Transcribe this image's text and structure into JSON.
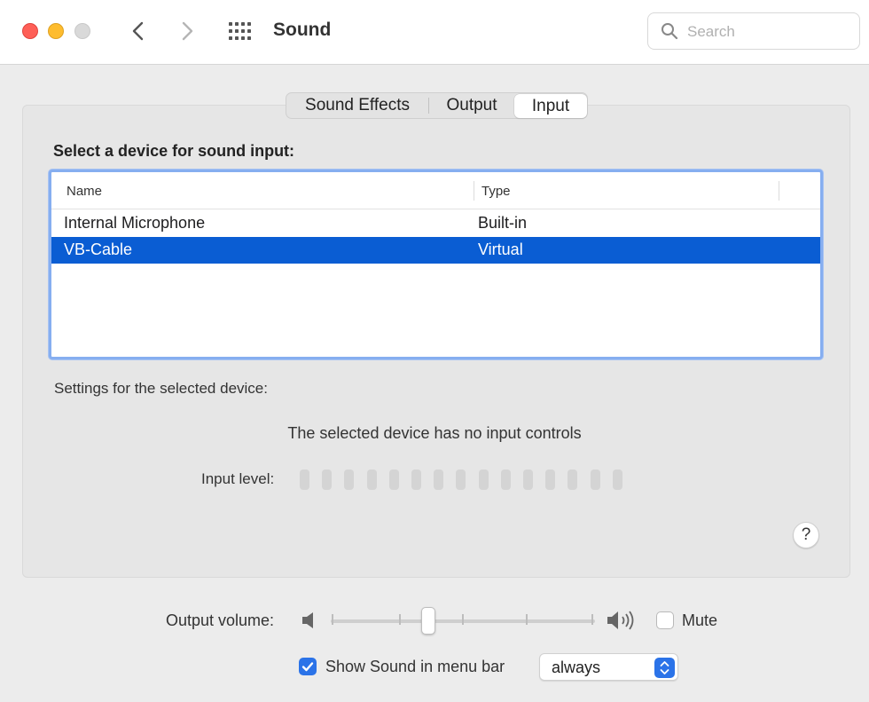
{
  "window": {
    "title": "Sound",
    "search_placeholder": "Search"
  },
  "tabs": [
    {
      "label": "Sound Effects",
      "selected": false
    },
    {
      "label": "Output",
      "selected": false
    },
    {
      "label": "Input",
      "selected": true
    }
  ],
  "input": {
    "section_title": "Select a device for sound input:",
    "columns": [
      "Name",
      "Type"
    ],
    "devices": [
      {
        "name": "Internal Microphone",
        "type": "Built-in",
        "selected": false
      },
      {
        "name": "VB-Cable",
        "type": "Virtual",
        "selected": true
      }
    ],
    "settings_label": "Settings for the selected device:",
    "no_controls_message": "The selected device has no input controls",
    "level_label": "Input level:",
    "level_segments": 15,
    "level_value": 0
  },
  "help": {
    "label": "?"
  },
  "output_volume": {
    "label": "Output volume:",
    "value": 0.37,
    "mute_label": "Mute",
    "muted": false
  },
  "menu_bar": {
    "show_label": "Show Sound in menu bar",
    "checked": true,
    "option": "always"
  },
  "colors": {
    "selection": "#0a5dd3",
    "accent": "#2b73e8",
    "focus_ring": "#86aef0"
  }
}
